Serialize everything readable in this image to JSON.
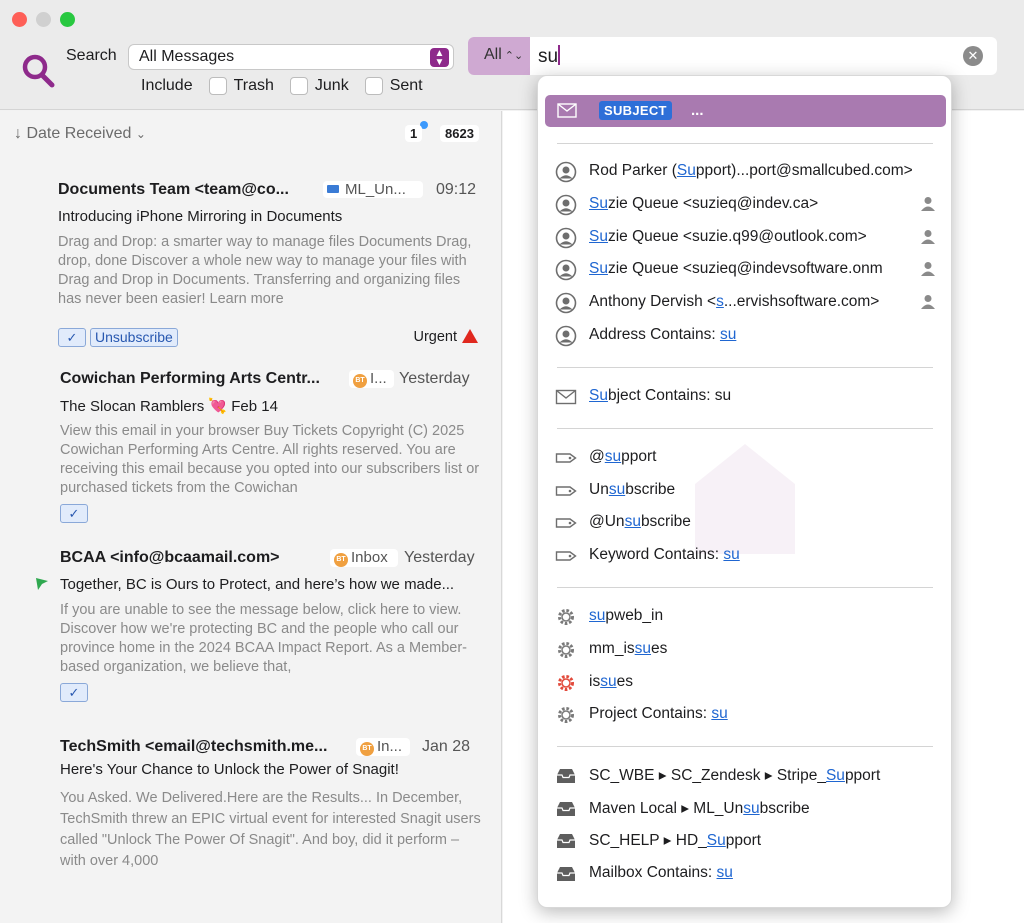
{
  "toolbar": {
    "search_label": "Search",
    "scope_value": "All Messages",
    "include_label": "Include",
    "include_options": [
      "Trash",
      "Junk",
      "Sent"
    ],
    "field_scope": "All",
    "query": "su"
  },
  "list": {
    "sort_label": "Date Received",
    "unread_count": "1",
    "total_count": "8623",
    "messages": [
      {
        "from": "Documents Team <team@co...",
        "mailbox": "ML_Un...",
        "date": "09:12",
        "subject": "Introducing iPhone Mirroring in Documents",
        "preview": "Drag and Drop: a smarter way to manage files Documents Drag, drop, done Discover a whole new way to manage your files with Drag and Drop in Documents. Transferring and organizing files has never been easier! Learn more",
        "tag": "Unsubscribe",
        "urgent": "Urgent"
      },
      {
        "from": "Cowichan Performing Arts Centr...",
        "mailbox": "I...",
        "date": "Yesterday",
        "subject": "The Slocan Ramblers 💘 Feb 14",
        "preview": "View this email in your browser Buy Tickets Copyright (C) 2025 Cowichan Performing Arts Centre. All rights reserved. You are receiving this email because you opted into our subscribers list or purchased tickets from the Cowichan"
      },
      {
        "from": "BCAA <info@bcaamail.com>",
        "mailbox": "Inbox",
        "date": "Yesterday",
        "subject": "Together, BC is Ours to Protect, and here’s how we made...",
        "preview": "If you are unable to see the message below, click here to view. Discover how we're protecting BC and the people who call our province home in the 2024 BCAA Impact Report. As a Member-based organization, we believe that,"
      },
      {
        "from": "TechSmith <email@techsmith.me...",
        "mailbox": "In...",
        "date": "Jan 28",
        "subject": "Here's Your Chance to Unlock the Power of Snagit!",
        "preview": "You Asked. We Delivered.Here are the Results... In December, TechSmith threw an EPIC virtual event for interested Snagit users called \"Unlock The Power Of Snagit\". And boy, did it perform – with over 4,000"
      }
    ],
    "check_glyph": "✓",
    "bt_badge": "BT"
  },
  "popup": {
    "head_token": "SUBJECT",
    "head_ellipsis": "...",
    "addresses": [
      {
        "pre": "Rod Parker (",
        "hl": "Su",
        "post": "pport)...port@smallcubed.com>"
      },
      {
        "pre": "",
        "hl": "Su",
        "post": "zie Queue <suzieq@indev.ca>"
      },
      {
        "pre": "",
        "hl": "Su",
        "post": "zie Queue <suzie.q99@outlook.com>"
      },
      {
        "pre": "",
        "hl": "Su",
        "post": "zie Queue <suzieq@indevsoftware.onm"
      },
      {
        "pre": "Anthony Dervish <",
        "hl": "s",
        "post": "...ervishsoftware.com>"
      },
      {
        "pre": "Address Contains: ",
        "hl": "su",
        "post": ""
      }
    ],
    "subject": {
      "pre": "",
      "hl": "Su",
      "post": "bject Contains: su"
    },
    "keywords": [
      {
        "pre": "@",
        "hl": "su",
        "post": "pport"
      },
      {
        "pre": "Un",
        "hl": "su",
        "post": "bscribe"
      },
      {
        "pre": "@Un",
        "hl": "su",
        "post": "bscribe"
      },
      {
        "pre": "Keyword Contains: ",
        "hl": "su",
        "post": ""
      }
    ],
    "projects": [
      {
        "pre": "",
        "hl": "su",
        "post": "pweb_in"
      },
      {
        "pre": "mm_is",
        "hl": "su",
        "post": "es"
      },
      {
        "pre": "is",
        "hl": "su",
        "post": "es"
      },
      {
        "pre": "Project Contains: ",
        "hl": "su",
        "post": ""
      }
    ],
    "mailboxes": [
      {
        "pre": "SC_WBE ▸ SC_Zendesk ▸ Stripe_",
        "hl": "Su",
        "post": "pport"
      },
      {
        "pre": "Maven Local ▸ ML_Un",
        "hl": "su",
        "post": "bscribe"
      },
      {
        "pre": "SC_HELP ▸ HD_",
        "hl": "Su",
        "post": "pport"
      },
      {
        "pre": "Mailbox Contains: ",
        "hl": "su",
        "post": ""
      }
    ]
  },
  "colors": {
    "accent": "#8e2a8b",
    "highlight": "#1f66d1",
    "popup_head": "#a97ab0"
  }
}
